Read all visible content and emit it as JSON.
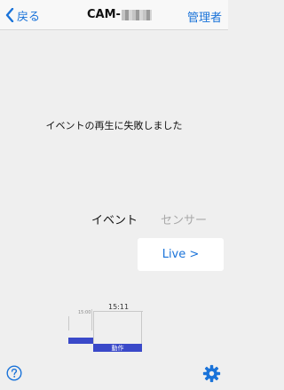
{
  "navbar": {
    "back_label": "戻る",
    "title": "CAM-",
    "admin_label": "管理者"
  },
  "player": {
    "error_message": "イベントの再生に失敗しました"
  },
  "tabs": {
    "event_label": "イベント",
    "sensor_label": "センサー"
  },
  "live_button": {
    "label": "Live >"
  },
  "timeline": {
    "small_time": "15:00",
    "main_time": "15:11",
    "event_label": "動作"
  },
  "icons": {
    "back": "chevron-left-icon",
    "help": "question-circle-icon",
    "settings": "gear-icon"
  },
  "colors": {
    "accent": "#1a73d9",
    "event_bar": "#3a49c9",
    "background": "#efefef"
  }
}
